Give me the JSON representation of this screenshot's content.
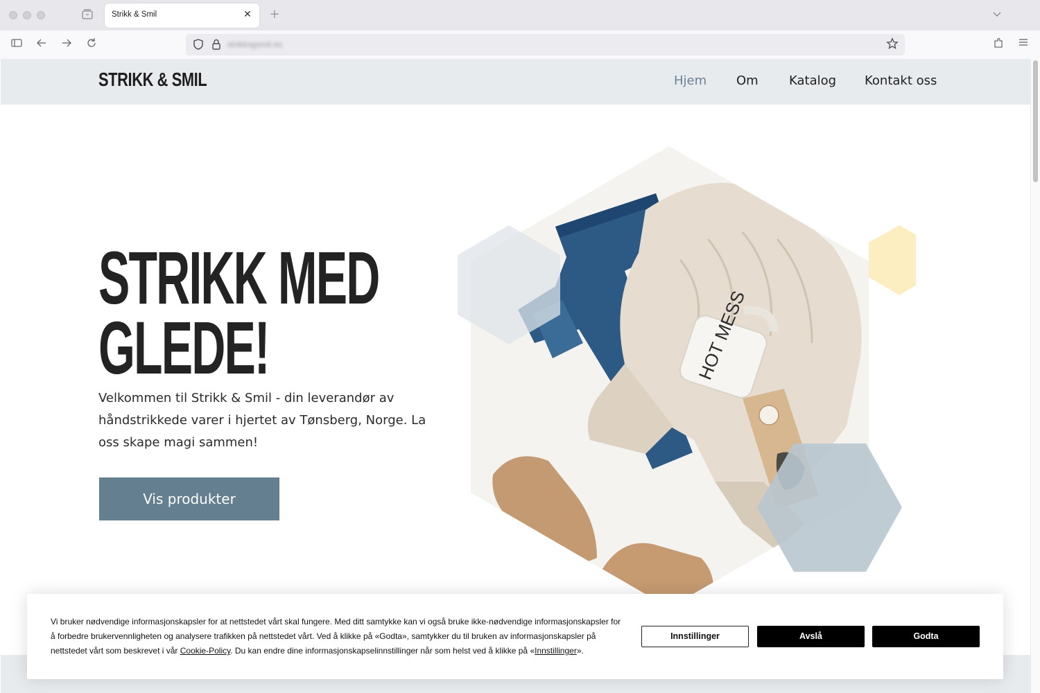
{
  "browser": {
    "tab_title": "Strikk & Smil",
    "url": "strikkogsmil.no",
    "new_tab_glyph": "+",
    "close_glyph": "✕"
  },
  "site": {
    "logo": "STRIKK & SMIL",
    "nav": [
      {
        "label": "Hjem",
        "active": true
      },
      {
        "label": "Om",
        "active": false
      },
      {
        "label": "Katalog",
        "active": false
      },
      {
        "label": "Kontakt oss",
        "active": false
      }
    ]
  },
  "hero": {
    "title_line1": "STRIKK MED",
    "title_line2": "GLEDE!",
    "text": "Velkommen til Strikk & Smil - din leverandør av håndstrikkede varer i hjertet av Tønsberg, Norge. La oss skape magi sammen!",
    "button": "Vis produkter",
    "mug_text": "HOT MESS"
  },
  "cookie": {
    "text_before_link": "Vi bruker nødvendige informasjonskapsler for at nettstedet vårt skal fungere. Med ditt samtykke kan vi også bruke ikke-nødvendige informasjonskapsler for å forbedre brukervennligheten og analysere trafikken på nettstedet vårt. Ved å klikke på «Godta», samtykker du til bruken av informasjonskapsler på nettstedet vårt som beskrevet i vår ",
    "policy_link": "Cookie-Policy",
    "text_middle": ". Du kan endre dine informasjonskapselinnstillinger når som helst ved å klikke på «",
    "settings_link": "Innstillinger",
    "text_end": "».",
    "btn_settings": "Innstillinger",
    "btn_reject": "Avslå",
    "btn_accept": "Godta"
  },
  "colors": {
    "accent": "#647f8f",
    "nav_active": "#6b8294",
    "hex_yellow": "#fdeec2",
    "hex_blue_gray": "#b8c6cf",
    "hex_light": "#e6eaee"
  }
}
